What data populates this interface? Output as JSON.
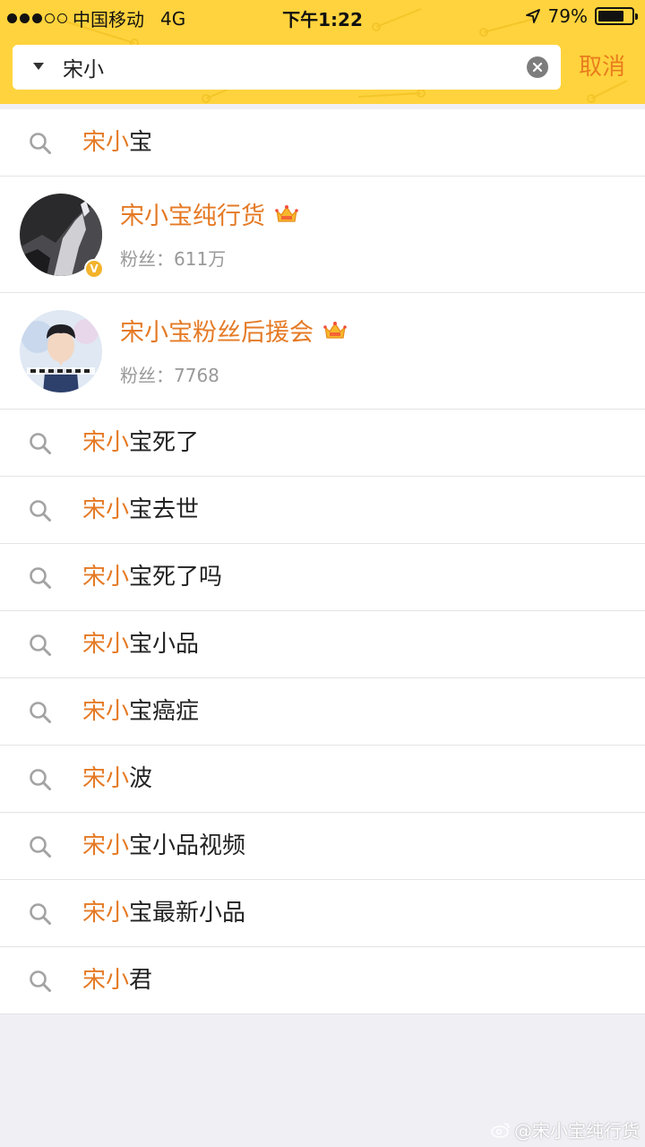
{
  "status": {
    "carrier": "中国移动",
    "network": "4G",
    "time": "下午1:22",
    "battery_percent": "79%",
    "battery_level": 0.79,
    "signal_bars_filled": 3,
    "signal_bars_total": 5
  },
  "search": {
    "query": "宋小",
    "placeholder": "",
    "cancel_label": "取消"
  },
  "suggestions_top": [
    {
      "highlight": "宋小",
      "rest": "宝"
    }
  ],
  "users": [
    {
      "name": "宋小宝纯行货",
      "highlight": "宋小",
      "rest": "宝纯行货",
      "fans_label": "粉丝：",
      "fans": "611万",
      "verified": true
    },
    {
      "name": "宋小宝粉丝后援会",
      "highlight": "宋小",
      "rest": "宝粉丝后援会",
      "fans_label": "粉丝：",
      "fans": "7768",
      "verified": false
    }
  ],
  "suggestions": [
    {
      "highlight": "宋小",
      "rest": "宝死了"
    },
    {
      "highlight": "宋小",
      "rest": "宝去世"
    },
    {
      "highlight": "宋小",
      "rest": "宝死了吗"
    },
    {
      "highlight": "宋小",
      "rest": "宝小品"
    },
    {
      "highlight": "宋小",
      "rest": "宝癌症"
    },
    {
      "highlight": "宋小",
      "rest": "波"
    },
    {
      "highlight": "宋小",
      "rest": "宝小品视频"
    },
    {
      "highlight": "宋小",
      "rest": "宝最新小品"
    },
    {
      "highlight": "宋小",
      "rest": "君"
    }
  ],
  "watermark": "@宋小宝纯行货",
  "colors": {
    "header_bg": "#ffd33d",
    "accent": "#e57a25",
    "cancel": "#e87d1e",
    "page_bg": "#efeff4"
  }
}
